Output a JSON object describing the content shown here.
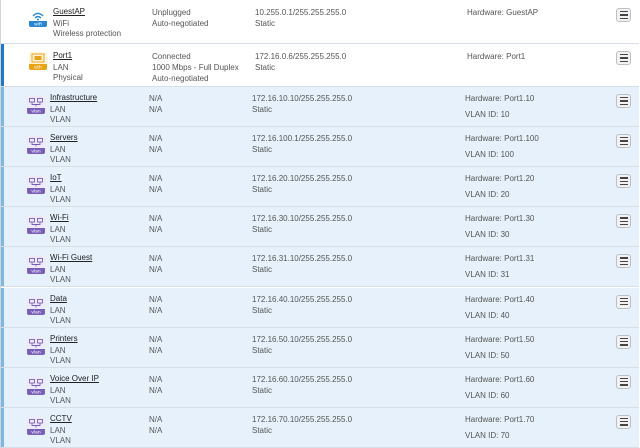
{
  "interfaces": [
    {
      "name": "GuestAP",
      "type": "WiFi",
      "sub": "Wireless protection",
      "icon": "wifi-icon",
      "icon_label": "wifi",
      "status": "Unplugged",
      "speed": "Auto-negotiated",
      "speed2": "",
      "ip": "10.255.0.1/255.255.255.0",
      "ip_mode": "Static",
      "hardware": "Hardware:  GuestAP",
      "vlan_id": ""
    },
    {
      "name": "Port1",
      "type": "LAN",
      "sub": "Physical",
      "icon": "ethernet-port-icon",
      "icon_label": "eth",
      "status": "Connected",
      "speed": "1000 Mbps - Full Duplex",
      "speed2": "Auto-negotiated",
      "ip": "172.16.0.6/255.255.255.0",
      "ip_mode": "Static",
      "hardware": "Hardware:  Port1",
      "vlan_id": ""
    }
  ],
  "vlans": [
    {
      "name": "Infrastructure",
      "type": "LAN",
      "sub": "VLAN",
      "icon_label": "vlan",
      "status": "N/A",
      "speed": "N/A",
      "ip": "172.16.10.10/255.255.255.0",
      "ip_mode": "Static",
      "hardware": "Hardware:  Port1.10",
      "vlan_id": "VLAN ID:  10"
    },
    {
      "name": "Servers",
      "type": "LAN",
      "sub": "VLAN",
      "icon_label": "vlan",
      "status": "N/A",
      "speed": "N/A",
      "ip": "172.16.100.1/255.255.255.0",
      "ip_mode": "Static",
      "hardware": "Hardware:  Port1.100",
      "vlan_id": "VLAN ID:  100"
    },
    {
      "name": "IoT",
      "type": "LAN",
      "sub": "VLAN",
      "icon_label": "vlan",
      "status": "N/A",
      "speed": "N/A",
      "ip": "172.16.20.10/255.255.255.0",
      "ip_mode": "Static",
      "hardware": "Hardware:  Port1.20",
      "vlan_id": "VLAN ID:  20"
    },
    {
      "name": "Wi-Fi",
      "type": "LAN",
      "sub": "VLAN",
      "icon_label": "vlan",
      "status": "N/A",
      "speed": "N/A",
      "ip": "172.16.30.10/255.255.255.0",
      "ip_mode": "Static",
      "hardware": "Hardware:  Port1.30",
      "vlan_id": "VLAN ID:  30"
    },
    {
      "name": "Wi-Fi Guest",
      "type": "LAN",
      "sub": "VLAN",
      "icon_label": "vlan",
      "status": "N/A",
      "speed": "N/A",
      "ip": "172.16.31.10/255.255.255.0",
      "ip_mode": "Static",
      "hardware": "Hardware:  Port1.31",
      "vlan_id": "VLAN ID:  31"
    },
    {
      "name": "Data",
      "type": "LAN",
      "sub": "VLAN",
      "icon_label": "vlan",
      "status": "N/A",
      "speed": "N/A",
      "ip": "172.16.40.10/255.255.255.0",
      "ip_mode": "Static",
      "hardware": "Hardware:  Port1.40",
      "vlan_id": "VLAN ID:  40"
    },
    {
      "name": "Printers",
      "type": "LAN",
      "sub": "VLAN",
      "icon_label": "vlan",
      "status": "N/A",
      "speed": "N/A",
      "ip": "172.16.50.10/255.255.255.0",
      "ip_mode": "Static",
      "hardware": "Hardware:  Port1.50",
      "vlan_id": "VLAN ID:  50"
    },
    {
      "name": "Voice Over IP",
      "type": "LAN",
      "sub": "VLAN",
      "icon_label": "vlan",
      "status": "N/A",
      "speed": "N/A",
      "ip": "172.16.60.10/255.255.255.0",
      "ip_mode": "Static",
      "hardware": "Hardware:  Port1.60",
      "vlan_id": "VLAN ID:  60"
    },
    {
      "name": "CCTV",
      "type": "LAN",
      "sub": "VLAN",
      "icon_label": "vlan",
      "status": "N/A",
      "speed": "N/A",
      "ip": "172.16.70.10/255.255.255.0",
      "ip_mode": "Static",
      "hardware": "Hardware:  Port1.70",
      "vlan_id": "VLAN ID:  70"
    }
  ],
  "colors": {
    "wifi_icon": "#2a86d4",
    "eth_icon": "#e8a317",
    "vlan_icon": "#7a5fb8",
    "selected_bar": "#1f78c8",
    "vlan_row_bg": "#e6f1fb"
  }
}
